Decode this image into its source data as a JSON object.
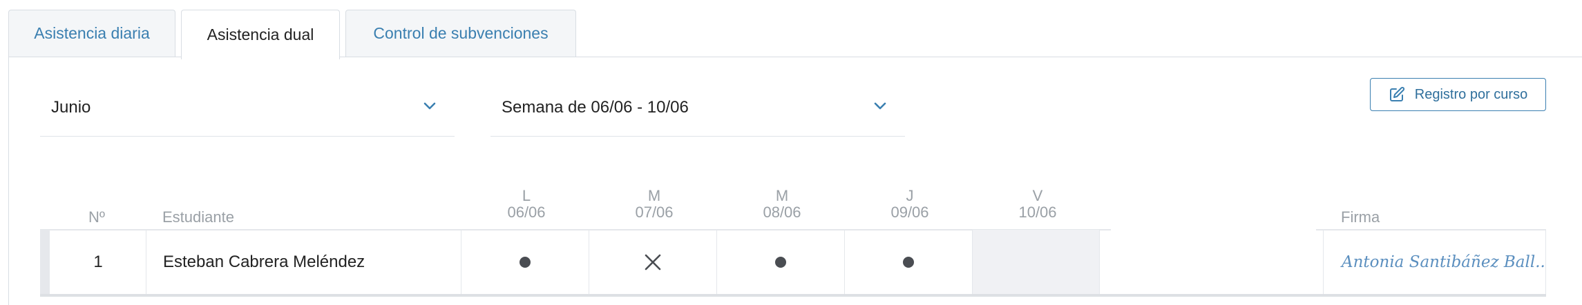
{
  "tabs": [
    {
      "label": "Asistencia diaria",
      "active": false
    },
    {
      "label": "Asistencia dual",
      "active": true
    },
    {
      "label": "Control de subvenciones",
      "active": false
    }
  ],
  "filters": {
    "month": "Junio",
    "week": "Semana de 06/06 - 10/06"
  },
  "actions": {
    "register_by_course": "Registro por curso",
    "register_icon": "edit-icon"
  },
  "table": {
    "headers": {
      "number": "Nº",
      "student": "Estudiante",
      "signature": "Firma"
    },
    "days": [
      {
        "letter": "L",
        "date": "06/06"
      },
      {
        "letter": "M",
        "date": "07/06"
      },
      {
        "letter": "M",
        "date": "08/06"
      },
      {
        "letter": "J",
        "date": "09/06"
      },
      {
        "letter": "V",
        "date": "10/06"
      }
    ],
    "rows": [
      {
        "number": "1",
        "student": "Esteban Cabrera Meléndez",
        "attendance": [
          "present",
          "absent",
          "present",
          "present",
          "disabled"
        ],
        "signature": "Antonia Santibáñez Ball..."
      }
    ]
  },
  "colors": {
    "accent": "#3a7fb0",
    "muted": "#9aa0a6",
    "disabled_cell": "#f0f1f4"
  }
}
